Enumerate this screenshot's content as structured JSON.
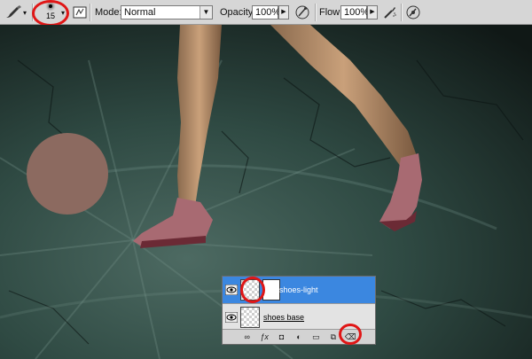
{
  "toolbar": {
    "brush_size": "15",
    "mode_label": "Mode:",
    "mode_value": "Normal",
    "opacity_label": "Opacity:",
    "opacity_value": "100%",
    "flow_label": "Flow:",
    "flow_value": "100%"
  },
  "layers": {
    "items": [
      {
        "name": "shoes-light",
        "selected": true
      },
      {
        "name": "shoes base",
        "selected": false
      }
    ]
  },
  "colors": {
    "selection_blue": "#3b87e0",
    "annotation_red": "#e01616",
    "brush_swatch": "#8c6a60",
    "ground_teal": "#2f4a43"
  }
}
